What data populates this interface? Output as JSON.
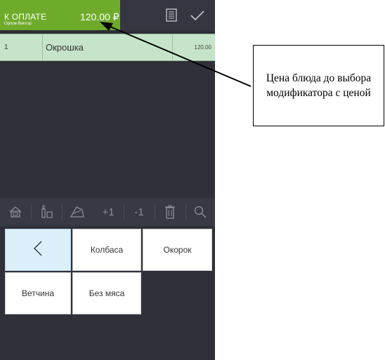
{
  "header": {
    "pay_label": "К ОПЛАТЕ",
    "waiter": "Орлов Виктор",
    "amount": "120.00 ₽",
    "icons": [
      "receipt-icon",
      "checkmark-icon"
    ]
  },
  "order": {
    "rows": [
      {
        "num": "1",
        "name": "Окрошка",
        "price": "120.00"
      }
    ]
  },
  "toolbar": {
    "items": [
      "home-icon",
      "bottle-icon",
      "dish-icon",
      "+1",
      "-1",
      "trash-icon",
      "search-icon"
    ],
    "plus_one": "+1",
    "minus_one": "-1"
  },
  "modifiers": {
    "back_glyph": "<",
    "items": [
      "Колбаса",
      "Окорок",
      "Ветчина",
      "Без мяса"
    ]
  },
  "callout": {
    "text": "Цена блюда до выбора модификатора с ценой"
  },
  "colors": {
    "pay_green": "#6fab2a",
    "row_green": "#c5e4c9",
    "dark_bg": "#2f3038",
    "back_button": "#dbeefa"
  }
}
